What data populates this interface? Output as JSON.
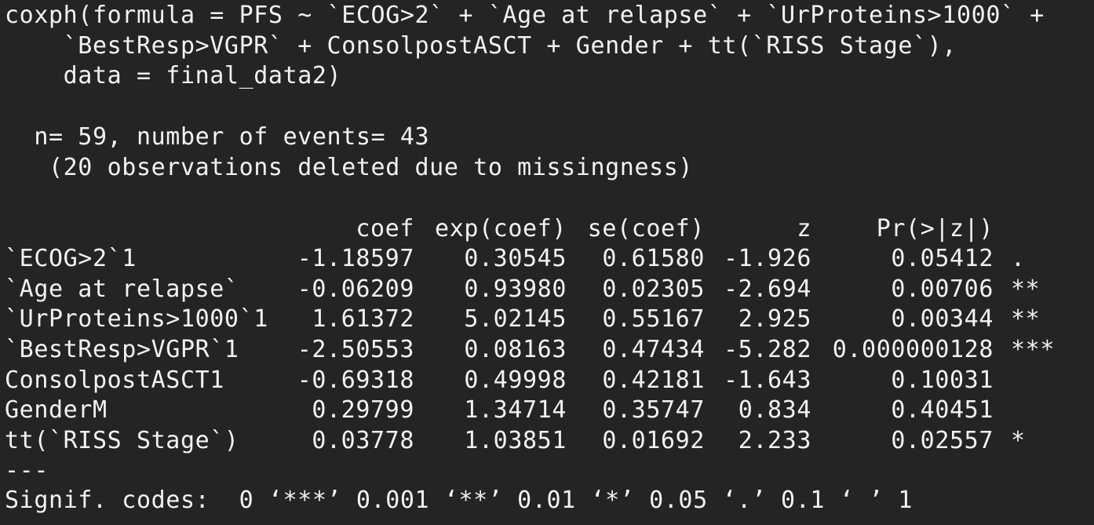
{
  "call": {
    "line1": "coxph(formula = PFS ~ `ECOG>2` + `Age at relapse` + `UrProteins>1000` +",
    "line2": "    `BestResp>VGPR` + ConsolpostASCT + Gender + tt(`RISS Stage`),",
    "line3": "    data = final_data2)"
  },
  "summary": {
    "n_line": "  n= 59, number of events= 43",
    "deleted_line": "   (20 observations deleted due to missingness)"
  },
  "table": {
    "headers": [
      "coef",
      "exp(coef)",
      "se(coef)",
      "z",
      "Pr(>|z|)"
    ],
    "rows": [
      {
        "term": "`ECOG>2`1",
        "coef": "-1.18597",
        "exp_coef": "0.30545",
        "se_coef": "0.61580",
        "z": "-1.926",
        "p": "0.05412",
        "sig": "."
      },
      {
        "term": "`Age at relapse`",
        "coef": "-0.06209",
        "exp_coef": "0.93980",
        "se_coef": "0.02305",
        "z": "-2.694",
        "p": "0.00706",
        "sig": "**"
      },
      {
        "term": "`UrProteins>1000`1",
        "coef": "1.61372",
        "exp_coef": "5.02145",
        "se_coef": "0.55167",
        "z": "2.925",
        "p": "0.00344",
        "sig": "**"
      },
      {
        "term": "`BestResp>VGPR`1",
        "coef": "-2.50553",
        "exp_coef": "0.08163",
        "se_coef": "0.47434",
        "z": "-5.282",
        "p": "0.000000128",
        "sig": "***"
      },
      {
        "term": "ConsolpostASCT1",
        "coef": "-0.69318",
        "exp_coef": "0.49998",
        "se_coef": "0.42181",
        "z": "-1.643",
        "p": "0.10031",
        "sig": ""
      },
      {
        "term": "GenderM",
        "coef": "0.29799",
        "exp_coef": "1.34714",
        "se_coef": "0.35747",
        "z": "0.834",
        "p": "0.40451",
        "sig": ""
      },
      {
        "term": "tt(`RISS Stage`)",
        "coef": "0.03778",
        "exp_coef": "1.03851",
        "se_coef": "0.01692",
        "z": "2.233",
        "p": "0.02557",
        "sig": "*"
      }
    ]
  },
  "footer": {
    "separator": "---",
    "signif_codes": "Signif. codes:  0 ‘***’ 0.001 ‘**’ 0.01 ‘*’ 0.05 ‘.’ 0.1 ‘ ’ 1"
  },
  "colors": {
    "background": "#242424",
    "text": "#f2f2f2"
  }
}
